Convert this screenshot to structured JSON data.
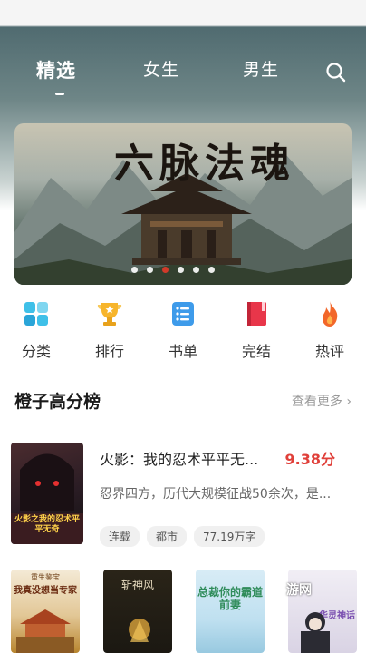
{
  "tabs": [
    {
      "label": "精选",
      "active": true
    },
    {
      "label": "女生",
      "active": false
    },
    {
      "label": "男生",
      "active": false
    }
  ],
  "banner": {
    "title": "六脉法魂",
    "dots_count": 6,
    "active_dot": 2
  },
  "categories": [
    {
      "label": "分类",
      "icon": "grid-icon",
      "color": "#39b7e6"
    },
    {
      "label": "排行",
      "icon": "trophy-icon",
      "color": "#f5b32b"
    },
    {
      "label": "书单",
      "icon": "list-icon",
      "color": "#3e9bea"
    },
    {
      "label": "完结",
      "icon": "book-icon",
      "color": "#e8364a"
    },
    {
      "label": "热评",
      "icon": "flame-icon",
      "color": "#f2672a"
    }
  ],
  "section": {
    "title": "橙子高分榜",
    "more_label": "查看更多"
  },
  "featured_book": {
    "title": "火影：我的忍术平平无...",
    "score": "9.38分",
    "description": "忍界四方，历代大规模征战50余次，是...",
    "tags": [
      "连载",
      "都市",
      "77.19万字"
    ],
    "cover_text": "火影之我的忍术平平无奇"
  },
  "more_books": [
    {
      "cover_text": "我真没想当专家",
      "cover_top_text": "重生鉴宝"
    },
    {
      "cover_text": "斩神风",
      "cover_top_text": ""
    },
    {
      "cover_text": "总裁你的霸道前妻",
      "cover_top_text": ""
    },
    {
      "cover_text": "游网",
      "cover_top_text": "华灵神话"
    }
  ],
  "watermark": "游网",
  "colors": {
    "score": "#e0403a",
    "dot_active": "#e23a2a"
  }
}
